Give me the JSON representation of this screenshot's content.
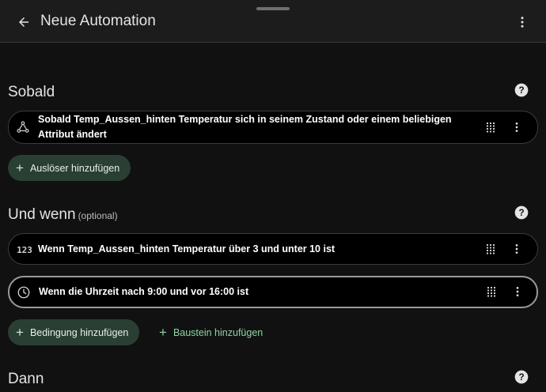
{
  "header": {
    "title": "Neue Automation"
  },
  "sections": {
    "trigger": {
      "title": "Sobald",
      "card": {
        "icon": "state-trigger-icon",
        "text": "Sobald Temp_Aussen_hinten Temperatur sich in seinem Zustand oder einem beliebigen Attribut ändert"
      },
      "add_label": "Auslöser hinzufügen"
    },
    "condition": {
      "title": "Und wenn",
      "optional": "(optional)",
      "cards": [
        {
          "icon": "numeric-123-icon",
          "icon_text": "123",
          "text": "Wenn Temp_Aussen_hinten Temperatur über 3 und unter 10 ist"
        },
        {
          "icon": "clock-icon",
          "text": "Wenn die Uhrzeit nach 9:00 und vor 16:00 ist"
        }
      ],
      "add_label": "Bedingung hinzufügen",
      "building_block_label": "Baustein hinzufügen"
    },
    "action": {
      "title": "Dann"
    }
  },
  "colors": {
    "background": "#111111",
    "card": "#000000",
    "add_button": "#2a3f33",
    "accent_text": "#8fd4a5"
  }
}
